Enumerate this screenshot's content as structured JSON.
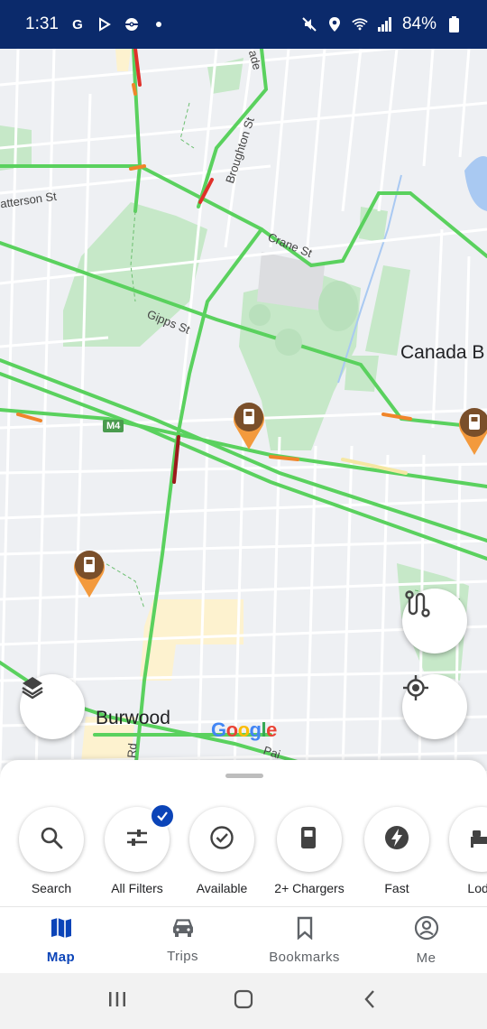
{
  "status_bar": {
    "time": "1:31",
    "battery": "84%",
    "left_icons": [
      "google-icon",
      "play-icon",
      "pokeball-icon",
      "dot-icon"
    ],
    "right_icons": [
      "mute-icon",
      "location-icon",
      "wifi-icon",
      "signal-icon",
      "battery-icon"
    ]
  },
  "map": {
    "streets": {
      "patterson": "atterson St",
      "broughton": "Broughton St",
      "crane": "Crane St",
      "gipps": "Gipps St",
      "parade": "ade",
      "burwood_rd": "Rd",
      "pai": "Pai"
    },
    "suburbs": {
      "canada_bay": "Canada B",
      "burwood": "Burwood"
    },
    "motorway_badge": "M4",
    "google_letters": [
      "G",
      "o",
      "o",
      "g",
      "l",
      "e"
    ],
    "colors": {
      "traffic_green": "#5ad15e",
      "traffic_orange": "#f0852a",
      "traffic_red": "#e0312a",
      "pin": "#f39a3d",
      "pin_head": "#7a4f2a",
      "park": "#c6e8c8",
      "water": "#a9c9f2",
      "commercial": "#fdf2cf"
    }
  },
  "map_controls": {
    "layers": "layers-icon",
    "route": "route-icon",
    "my_location": "my-location-icon"
  },
  "filters": [
    {
      "label": "Search",
      "icon": "search-icon",
      "selected": false
    },
    {
      "label": "All Filters",
      "icon": "sliders-icon",
      "selected": true
    },
    {
      "label": "Available",
      "icon": "check-circle-icon",
      "selected": false
    },
    {
      "label": "2+ Chargers",
      "icon": "fuel-pump-icon",
      "selected": false
    },
    {
      "label": "Fast",
      "icon": "bolt-icon",
      "selected": false
    },
    {
      "label": "Lodg",
      "icon": "bed-icon",
      "selected": false
    }
  ],
  "bottom_nav": [
    {
      "label": "Map",
      "icon": "map-icon",
      "active": true
    },
    {
      "label": "Trips",
      "icon": "car-icon",
      "active": false
    },
    {
      "label": "Bookmarks",
      "icon": "bookmark-icon",
      "active": false
    },
    {
      "label": "Me",
      "icon": "account-icon",
      "active": false
    }
  ],
  "accent_color": "#0b44b8",
  "header_color": "#0b2a6b"
}
